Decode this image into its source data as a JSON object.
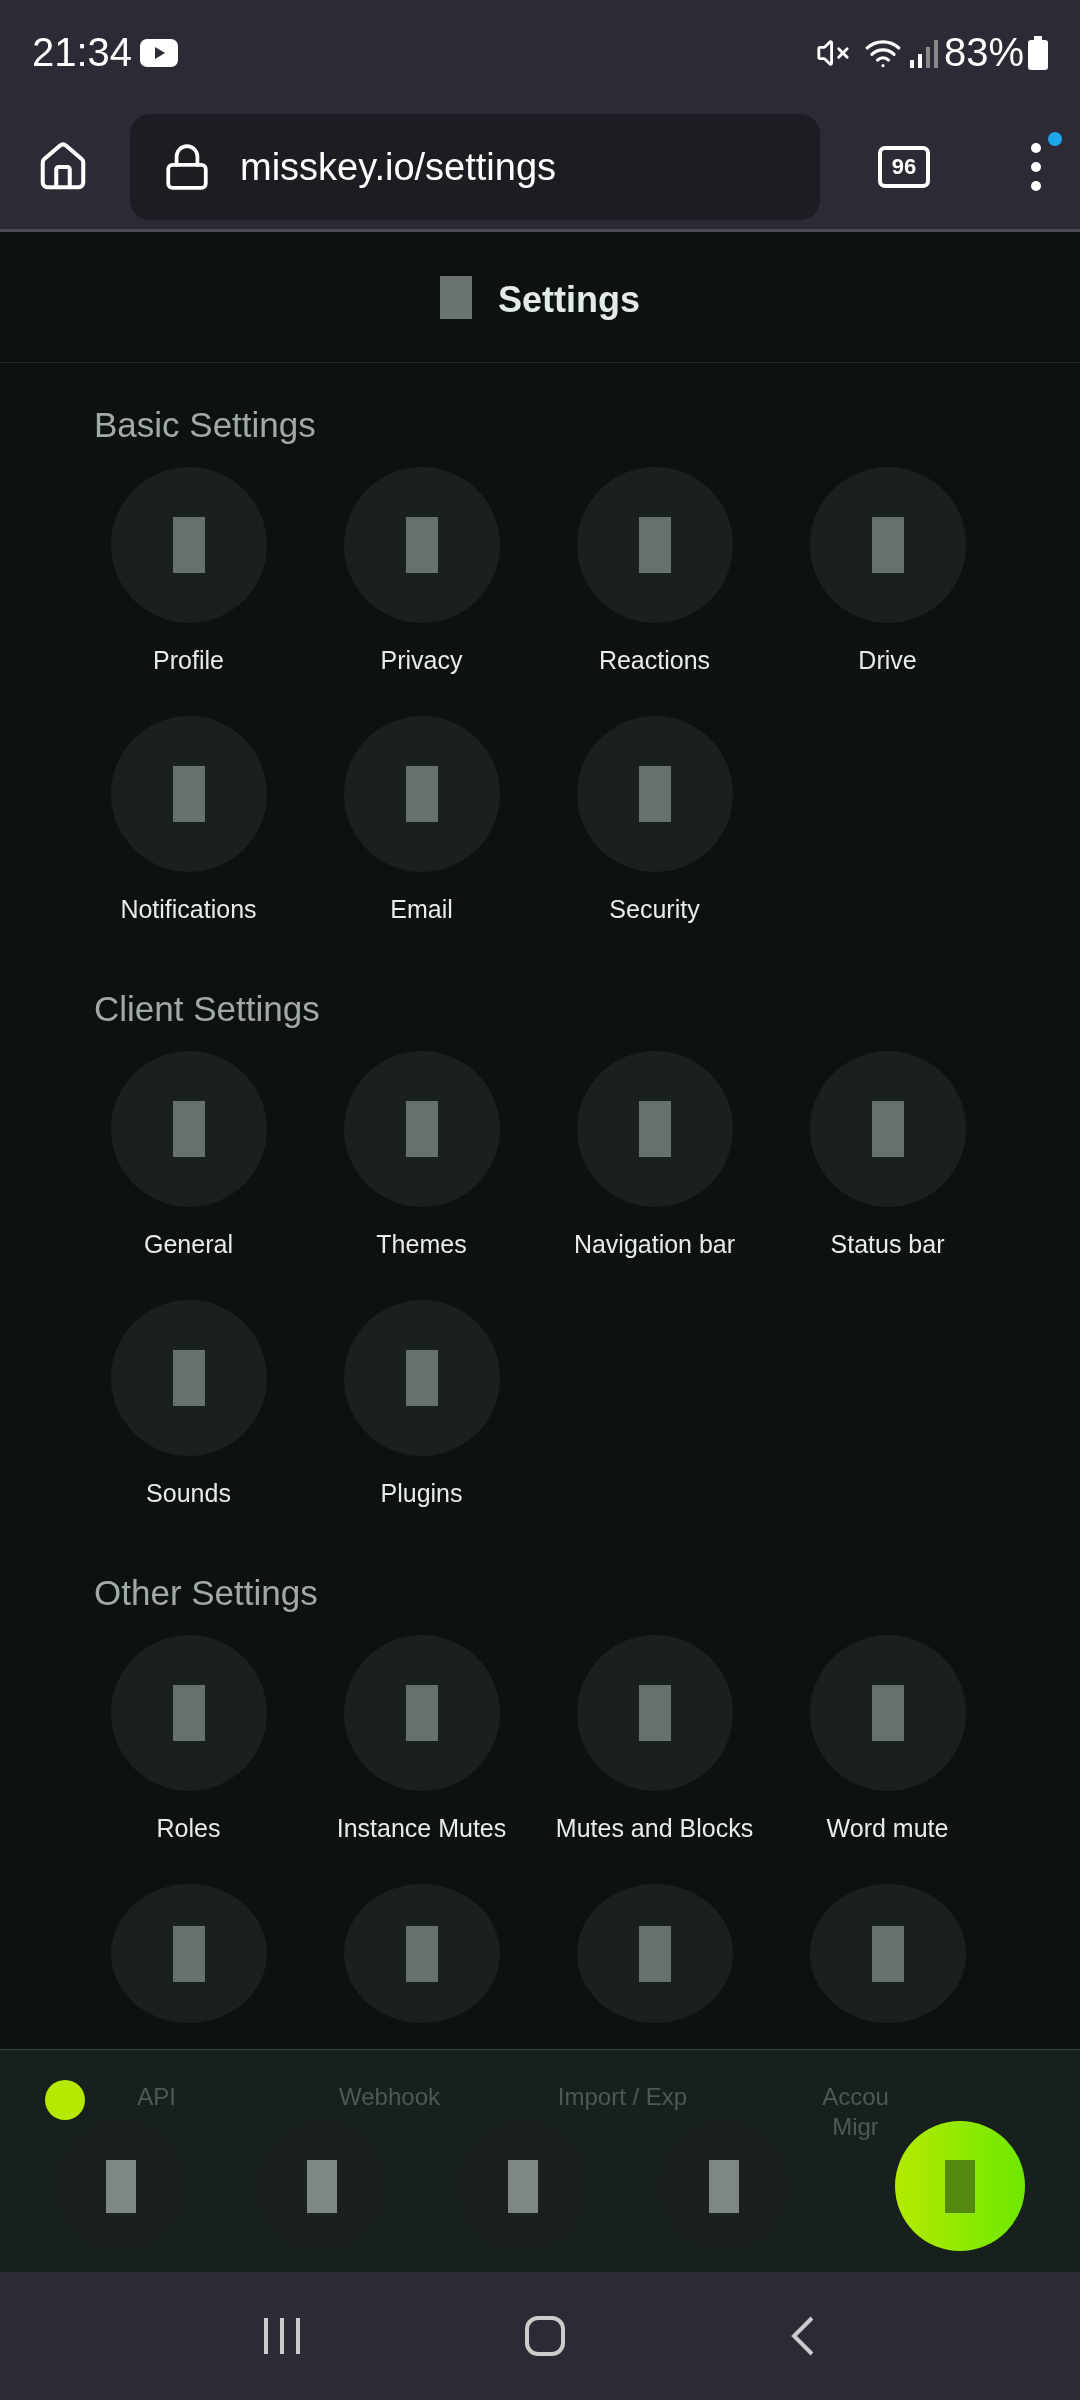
{
  "status_bar": {
    "time": "21:34",
    "battery": "83%"
  },
  "browser": {
    "url": "misskey.io/settings",
    "tab_count": "96",
    "menu_badge": true
  },
  "header": {
    "title": "Settings"
  },
  "sections": [
    {
      "title": "Basic Settings",
      "items": [
        {
          "label": "Profile"
        },
        {
          "label": "Privacy"
        },
        {
          "label": "Reactions"
        },
        {
          "label": "Drive"
        },
        {
          "label": "Notifications"
        },
        {
          "label": "Email"
        },
        {
          "label": "Security"
        }
      ]
    },
    {
      "title": "Client Settings",
      "items": [
        {
          "label": "General"
        },
        {
          "label": "Themes"
        },
        {
          "label": "Navigation bar"
        },
        {
          "label": "Status bar"
        },
        {
          "label": "Sounds"
        },
        {
          "label": "Plugins"
        }
      ]
    },
    {
      "title": "Other Settings",
      "items": [
        {
          "label": "Roles"
        },
        {
          "label": "Instance Mutes"
        },
        {
          "label": "Mutes and Blocks"
        },
        {
          "label": "Word mute"
        },
        {
          "label": "API",
          "obscured": true
        },
        {
          "label": "Webhook",
          "obscured": true
        },
        {
          "label": "Import / Exp",
          "obscured": true
        },
        {
          "label": "Accou\nMigr",
          "obscured": true
        }
      ]
    }
  ],
  "bottom_nav": {
    "indicator": true,
    "buttons": [
      {
        "kind": "plain"
      },
      {
        "kind": "plain"
      },
      {
        "kind": "plain"
      },
      {
        "kind": "plain"
      },
      {
        "kind": "accent"
      }
    ]
  }
}
